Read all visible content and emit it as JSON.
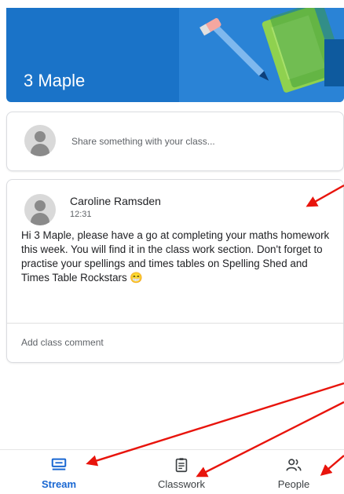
{
  "banner": {
    "class_name": "3 Maple",
    "color": "#1a73c8"
  },
  "share": {
    "placeholder": "Share something with your class..."
  },
  "post": {
    "author": "Caroline Ramsden",
    "time": "12:31",
    "body": "Hi 3 Maple, please have a go at completing your maths homework this week.  You will find it in the class work section. Don't forget to practise your spellings and times tables on Spelling Shed and Times Table Rockstars 😁",
    "comment_placeholder": "Add class comment"
  },
  "nav": {
    "items": [
      {
        "label": "Stream",
        "icon": "stream-icon",
        "active": true,
        "color": "#1967d2"
      },
      {
        "label": "Classwork",
        "icon": "clipboard-icon",
        "active": false,
        "color": "#3c4043"
      },
      {
        "label": "People",
        "icon": "people-icon",
        "active": false,
        "color": "#3c4043"
      }
    ]
  },
  "annotation_color": "#e8140c"
}
